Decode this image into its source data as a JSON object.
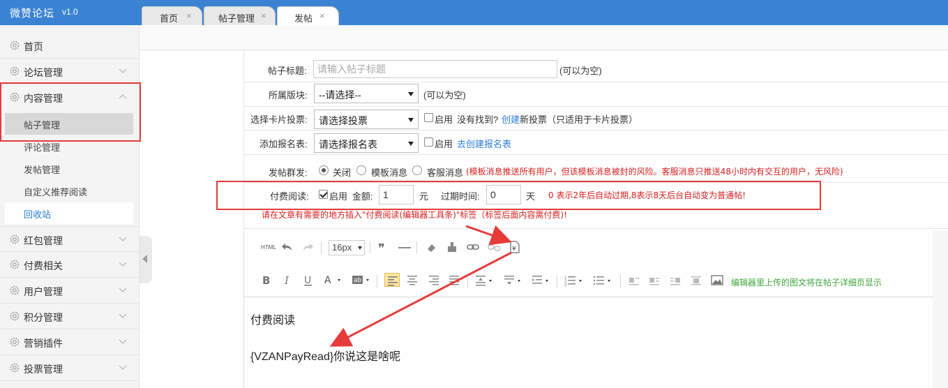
{
  "app": {
    "title": "微赞论坛",
    "version": "v1.0"
  },
  "sidebar": {
    "items": [
      {
        "label": "首页"
      },
      {
        "label": "论坛管理"
      },
      {
        "label": "内容管理"
      },
      {
        "label": "红包管理"
      },
      {
        "label": "付费相关"
      },
      {
        "label": "用户管理"
      },
      {
        "label": "积分管理"
      },
      {
        "label": "营销插件"
      },
      {
        "label": "投票管理"
      }
    ],
    "content_sub": [
      {
        "label": "帖子管理"
      },
      {
        "label": "评论管理"
      },
      {
        "label": "发帖管理"
      },
      {
        "label": "自定义推荐阅读"
      },
      {
        "label": "回收站"
      }
    ]
  },
  "tabs": [
    {
      "label": "首页",
      "close": "×"
    },
    {
      "label": "帖子管理",
      "close": "×"
    },
    {
      "label": "发帖",
      "close": "×"
    }
  ],
  "form": {
    "title_label": "帖子标题:",
    "title_placeholder": "请输入帖子标题",
    "title_hint": "(可以为空)",
    "section_label": "所属版块:",
    "section_value": "--请选择--",
    "section_hint": "(可以为空)",
    "vote_label": "选择卡片投票:",
    "vote_value": "请选择投票",
    "vote_enable": "启用",
    "vote_hint_pre": "没有找到?",
    "vote_hint_link": "创建",
    "vote_hint_post": "新投票（只适用于卡片投票）",
    "signup_label": "添加报名表:",
    "signup_value": "请选择报名表",
    "signup_enable": "启用",
    "signup_link": "去创建报名表",
    "mass_label": "发帖群发:",
    "mass_opt1": "关闭",
    "mass_opt2": "模板消息",
    "mass_opt3": "客服消息",
    "mass_warning": "(模板消息推送所有用户，但该模板消息被封的风险。客服消息只推送48小时内有交互的用户，无风险)",
    "paid_label": "付费阅读:",
    "paid_enable": "启用",
    "amount_label": "金额:",
    "amount_value": "1",
    "amount_unit": "元",
    "expire_label": "过期时间:",
    "expire_value": "0",
    "expire_unit": "天",
    "expire_note": "0 表示2年后自动过期,8表示8天后台自动变为普通帖!",
    "insert_note": "请在文章有需要的地方插入\"付费阅读(编辑器工具条)\"标签（标签后面内容需付费)!"
  },
  "editor": {
    "font_size": "16px",
    "html_label": "HTML",
    "note": "编辑器里上传的图文将在帖子详细页显示",
    "line1": "付费阅读",
    "line2": "{VZANPayRead}你说这是啥呢"
  },
  "colors": {
    "header": "#3a83d3",
    "highlight": "#e63b3b",
    "link": "#2a7ed3"
  }
}
